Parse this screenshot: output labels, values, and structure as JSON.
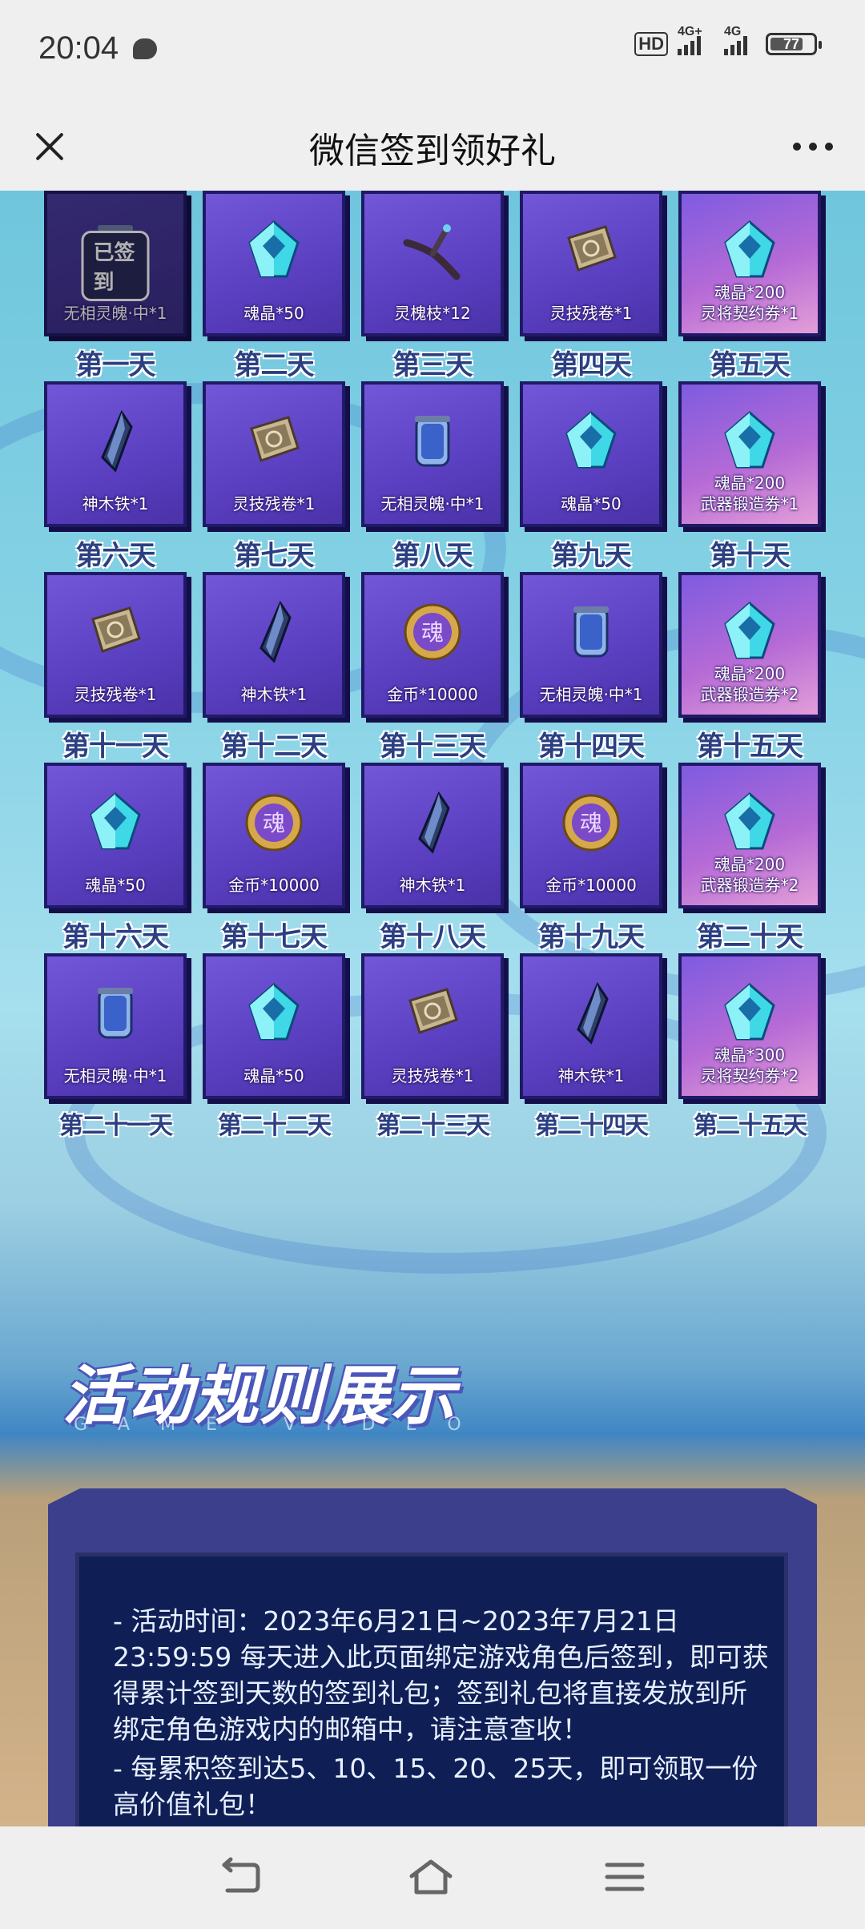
{
  "status_bar": {
    "time": "20:04",
    "hd": "HD",
    "network1": "4G+",
    "network2": "4G",
    "battery": "77",
    "battery_fraction": 0.77
  },
  "title_bar": {
    "title": "微信签到领好礼",
    "close_icon": "close-icon",
    "more_icon": "more-icon"
  },
  "signed_text": "已签到",
  "days": [
    {
      "day": "第一天",
      "lines": [
        "无相灵魄·中*1"
      ],
      "icon": "vase",
      "signed": true
    },
    {
      "day": "第二天",
      "lines": [
        "魂晶*50"
      ],
      "icon": "crystal"
    },
    {
      "day": "第三天",
      "lines": [
        "灵槐枝*12"
      ],
      "icon": "branch"
    },
    {
      "day": "第四天",
      "lines": [
        "灵技残卷*1"
      ],
      "icon": "scroll"
    },
    {
      "day": "第五天",
      "lines": [
        "魂晶*200",
        "灵将契约券*1"
      ],
      "icon": "crystal",
      "special": true
    },
    {
      "day": "第六天",
      "lines": [
        "神木铁*1"
      ],
      "icon": "iron"
    },
    {
      "day": "第七天",
      "lines": [
        "灵技残卷*1"
      ],
      "icon": "scroll"
    },
    {
      "day": "第八天",
      "lines": [
        "无相灵魄·中*1"
      ],
      "icon": "vase"
    },
    {
      "day": "第九天",
      "lines": [
        "魂晶*50"
      ],
      "icon": "crystal"
    },
    {
      "day": "第十天",
      "lines": [
        "魂晶*200",
        "武器锻造券*1"
      ],
      "icon": "crystal",
      "special": true
    },
    {
      "day": "第十一天",
      "lines": [
        "灵技残卷*1"
      ],
      "icon": "scroll"
    },
    {
      "day": "第十二天",
      "lines": [
        "神木铁*1"
      ],
      "icon": "iron"
    },
    {
      "day": "第十三天",
      "lines": [
        "金币*10000"
      ],
      "icon": "coin"
    },
    {
      "day": "第十四天",
      "lines": [
        "无相灵魄·中*1"
      ],
      "icon": "vase"
    },
    {
      "day": "第十五天",
      "lines": [
        "魂晶*200",
        "武器锻造券*2"
      ],
      "icon": "crystal",
      "special": true
    },
    {
      "day": "第十六天",
      "lines": [
        "魂晶*50"
      ],
      "icon": "crystal"
    },
    {
      "day": "第十七天",
      "lines": [
        "金币*10000"
      ],
      "icon": "coin"
    },
    {
      "day": "第十八天",
      "lines": [
        "神木铁*1"
      ],
      "icon": "iron"
    },
    {
      "day": "第十九天",
      "lines": [
        "金币*10000"
      ],
      "icon": "coin"
    },
    {
      "day": "第二十天",
      "lines": [
        "魂晶*200",
        "武器锻造券*2"
      ],
      "icon": "crystal",
      "special": true
    },
    {
      "day": "第二十一天",
      "lines": [
        "无相灵魄·中*1"
      ],
      "icon": "vase"
    },
    {
      "day": "第二十二天",
      "lines": [
        "魂晶*50"
      ],
      "icon": "crystal"
    },
    {
      "day": "第二十三天",
      "lines": [
        "灵技残卷*1"
      ],
      "icon": "scroll"
    },
    {
      "day": "第二十四天",
      "lines": [
        "神木铁*1"
      ],
      "icon": "iron"
    },
    {
      "day": "第二十五天",
      "lines": [
        "魂晶*300",
        "灵将契约券*2"
      ],
      "icon": "crystal",
      "special": true
    }
  ],
  "rules": {
    "title": "活动规则展示",
    "subtitle": "GAME VIDEO",
    "paragraphs": [
      "- 活动时间：2023年6月21日~2023年7月21日23:59:59 每天进入此页面绑定游戏角色后签到，即可获得累计签到天数的签到礼包；签到礼包将直接发放到所绑定角色游戏内的邮箱中，请注意查收！",
      "- 每累积签到达5、10、15、20、25天，即可领取一份高价值礼包！"
    ]
  },
  "nav": {
    "back_icon": "back-icon",
    "home_icon": "home-icon",
    "menu_icon": "menu-icon"
  }
}
